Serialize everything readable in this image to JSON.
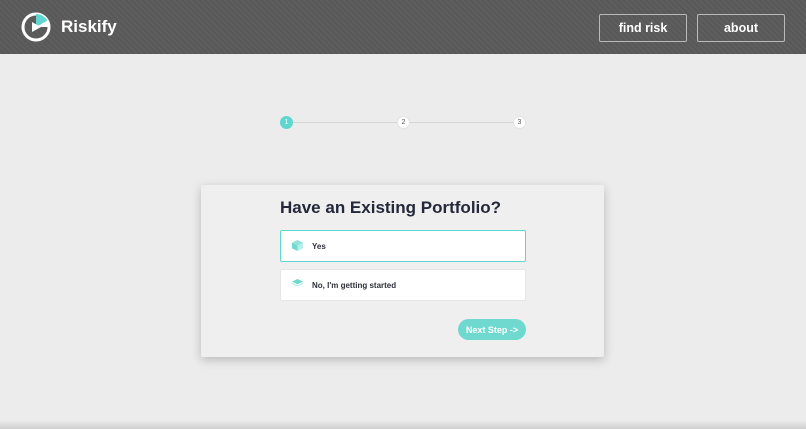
{
  "header": {
    "brand": "Riskify",
    "nav": [
      {
        "label": "find risk"
      },
      {
        "label": "about"
      }
    ]
  },
  "stepper": {
    "current": 1,
    "steps": [
      {
        "label": "1"
      },
      {
        "label": "2"
      },
      {
        "label": "3"
      }
    ]
  },
  "card": {
    "title": "Have an Existing Portfolio?",
    "options": [
      {
        "label": "Yes",
        "icon": "cube-icon",
        "selected": true
      },
      {
        "label": "No, I'm getting started",
        "icon": "layers-icon",
        "selected": false
      }
    ],
    "next_label": "Next Step ->"
  },
  "colors": {
    "accent": "#5fd6cf",
    "header_bg": "#585858",
    "page_bg": "#ececec",
    "title_text": "#24283a"
  }
}
